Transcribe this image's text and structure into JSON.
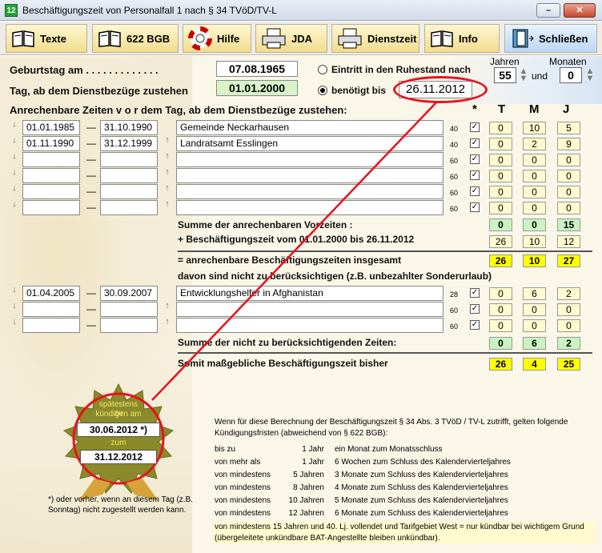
{
  "window": {
    "title": "Beschäftigungszeit von  Personalfall 1  nach § 34 TVöD/TV-L",
    "app_icon": "12",
    "minimize": "⎯",
    "close": "✕"
  },
  "toolbar": [
    {
      "label": "Texte",
      "icon": "book-icon"
    },
    {
      "label": "622 BGB",
      "icon": "book-icon"
    },
    {
      "label": "Hilfe",
      "icon": "lifebuoy-icon"
    },
    {
      "label": "JDA",
      "icon": "printer-icon"
    },
    {
      "label": "Dienstzeit",
      "icon": "printer-icon"
    },
    {
      "label": "Info",
      "icon": "book-icon"
    },
    {
      "label": "Schließen",
      "icon": "exit-door-icon"
    }
  ],
  "header": {
    "birthday_label": "Geburtstag am . . . . . . . . . . . . .",
    "birthday": "07.08.1965",
    "entitled_label": "Tag, ab dem Dienstbezüge zustehen",
    "entitled": "01.01.2000",
    "opt_retire": "Eintritt in den Ruhestand nach",
    "opt_needed": "benötigt bis",
    "needed_date": "26.11.2012",
    "years_label": "Jahren",
    "months_label": "Monaten",
    "years": "55",
    "und": "und",
    "months": "0"
  },
  "section1": {
    "title": "Anrechenbare Zeiten   v o r   dem Tag, ab dem Dienstbezüge zustehen:",
    "col_star": "*",
    "col_t": "T",
    "col_m": "M",
    "col_j": "J",
    "rows": [
      {
        "from": "01.01.1985",
        "to": "31.10.1990",
        "desc": "Gemeinde Neckarhausen",
        "factor": "40",
        "chk": "✓",
        "t": "0",
        "m": "10",
        "j": "5"
      },
      {
        "from": "01.11.1990",
        "to": "31.12.1999",
        "desc": "Landratsamt Esslingen",
        "factor": "40",
        "chk": "✓",
        "t": "0",
        "m": "2",
        "j": "9"
      },
      {
        "from": "",
        "to": "",
        "desc": "",
        "factor": "60",
        "chk": "✓",
        "t": "0",
        "m": "0",
        "j": "0"
      },
      {
        "from": "",
        "to": "",
        "desc": "",
        "factor": "60",
        "chk": "✓",
        "t": "0",
        "m": "0",
        "j": "0"
      },
      {
        "from": "",
        "to": "",
        "desc": "",
        "factor": "60",
        "chk": "✓",
        "t": "0",
        "m": "0",
        "j": "0"
      },
      {
        "from": "",
        "to": "",
        "desc": "",
        "factor": "60",
        "chk": "✓",
        "t": "0",
        "m": "0",
        "j": "0"
      }
    ],
    "sum_label": "Summe der anrechenbaren Vorzeiten :",
    "sum": {
      "t": "0",
      "m": "0",
      "j": "15"
    },
    "plus_label": "+ Beschäftigungszeit vom  01.01.2000  bis    26.11.2012",
    "plus": {
      "t": "26",
      "m": "10",
      "j": "12"
    },
    "total_label": "= anrechenbare Beschäftigungszeiten insgesamt",
    "total": {
      "t": "26",
      "m": "10",
      "j": "27"
    },
    "exclude_label": "davon sind nicht zu berücksichtigen (z.B. unbezahlter Sonderurlaub)"
  },
  "section2": {
    "rows": [
      {
        "from": "01.04.2005",
        "to": "30.09.2007",
        "desc": "Entwicklungshelfer in Afghanistan",
        "factor": "28",
        "chk": "✓",
        "t": "0",
        "m": "6",
        "j": "2"
      },
      {
        "from": "",
        "to": "",
        "desc": "",
        "factor": "60",
        "chk": "✓",
        "t": "0",
        "m": "0",
        "j": "0"
      },
      {
        "from": "",
        "to": "",
        "desc": "",
        "factor": "60",
        "chk": "✓",
        "t": "0",
        "m": "0",
        "j": "0"
      }
    ],
    "sum_label": "Summe der nicht zu berücksichtigenden Zeiten:",
    "sum": {
      "t": "0",
      "m": "6",
      "j": "2"
    },
    "final_label": "Somit maßgebliche Beschäftigungszeit bisher",
    "final": {
      "t": "26",
      "m": "4",
      "j": "25"
    }
  },
  "seal": {
    "line1": "spätestens zu",
    "line2": "kündigen am",
    "date1": "30.06.2012 *)",
    "zum": "zum",
    "date2": "31.12.2012"
  },
  "footnote": "*) oder vorher, wenn an diesem Tag (z.B. Sonntag) nicht zugestellt werden kann.",
  "notice": {
    "intro": "Wenn für diese Berechnung der Beschäftigungszeit § 34 Abs. 3 TVöD / TV-L zutrifft, gelten folgende Kündigungsfristen (abweichend von § 622 BGB):",
    "rows": [
      [
        "bis zu",
        "1 Jahr",
        "ein Monat zum Monatsschluss"
      ],
      [
        "von mehr als",
        "1 Jahr",
        "6 Wochen zum Schluss des Kalendervierteljahres"
      ],
      [
        "von mindestens",
        "5 Jahren",
        "3 Monate zum Schluss des Kalendervierteljahres"
      ],
      [
        "von mindestens",
        "8 Jahren",
        "4 Monate zum Schluss des Kalendervierteljahres"
      ],
      [
        "von mindestens",
        "10 Jahren",
        "5 Monate zum Schluss des Kalendervierteljahres"
      ],
      [
        "von mindestens",
        "12 Jahren",
        "6 Monate zum Schluss des Kalendervierteljahres"
      ]
    ],
    "last": "von mindestens  15 Jahren und 40. Lj. vollendet und Tarifgebiet West = nur kündbar bei wichtigem Grund (übergeleitete unkündbare BAT-Angestellte bleiben unkündbar)."
  }
}
